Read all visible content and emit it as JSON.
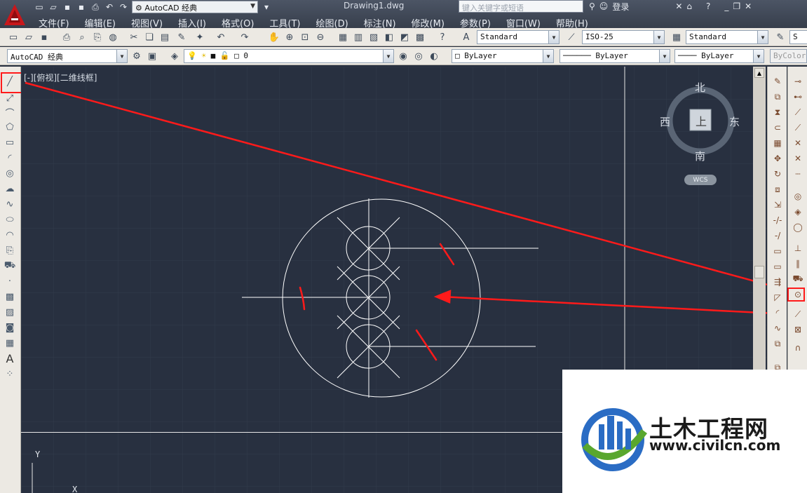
{
  "app": {
    "document_title": "Drawing1.dwg",
    "workspace": "AutoCAD 经典",
    "search_placeholder": "键入关键字或短语",
    "login_label": "登录"
  },
  "menu": [
    "文件(F)",
    "编辑(E)",
    "视图(V)",
    "插入(I)",
    "格式(O)",
    "工具(T)",
    "绘图(D)",
    "标注(N)",
    "修改(M)",
    "参数(P)",
    "窗口(W)",
    "帮助(H)"
  ],
  "toolbar_styles": {
    "text_style": "Standard",
    "dim_style": "ISO-25",
    "table_style": "Standard",
    "multileader_style": "S"
  },
  "toolbar_layers": {
    "workspace_combo": "AutoCAD 经典",
    "layer_name": "0",
    "color": "ByLayer",
    "linetype": "ByLayer",
    "lineweight": "ByLayer",
    "plotstyle": "ByColor"
  },
  "viewport": {
    "label": "[-][俯视][二维线框]",
    "viewcube": {
      "north": "北",
      "south": "南",
      "west": "西",
      "east": "东",
      "face": "上"
    },
    "wcs_label": "WCS",
    "ucs_x": "X",
    "ucs_y": "Y"
  },
  "watermark": {
    "name": "土木工程网",
    "url": "www.civilcn.com"
  },
  "colors": {
    "canvas": "#283040",
    "annotation": "#ff1a1a",
    "geometry": "#ffffff"
  }
}
